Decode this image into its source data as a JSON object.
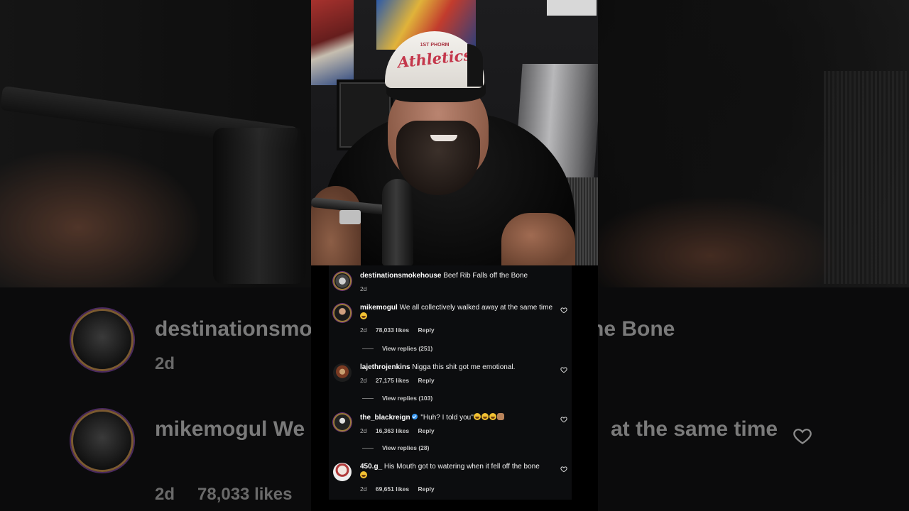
{
  "background": {
    "username": "destinationsmo",
    "username_tail": "he Bone",
    "time": "2d",
    "second_username": "mikemogul We",
    "second_tail": "at the same time",
    "second_time": "2d",
    "second_likes": "78,033 likes"
  },
  "video": {
    "cap_small_text": "1ST PHORM",
    "cap_logo_text": "Athletics"
  },
  "comments": [
    {
      "username": "destinationsmokehouse",
      "text": "Beef Rib Falls off the Bone",
      "time": "2d",
      "likes": "",
      "reply_label": "",
      "avatar_icon": "smokehouse-logo-icon",
      "view_replies": ""
    },
    {
      "username": "mikemogul",
      "text": "We all collectively walked away at the same time",
      "time": "2d",
      "likes": "78,033 likes",
      "reply_label": "Reply",
      "avatar_icon": "user-avatar-icon",
      "view_replies": "View replies (251)"
    },
    {
      "username": "lajethrojenkins",
      "text": "Nigga this shit got me emotional.",
      "time": "2d",
      "likes": "27,175 likes",
      "reply_label": "Reply",
      "avatar_icon": "user-avatar-icon",
      "view_replies": "View replies (103)"
    },
    {
      "username": "the_blackreign",
      "text": "\"Huh? I told you\"",
      "time": "2d",
      "likes": "16,363 likes",
      "reply_label": "Reply",
      "avatar_icon": "user-avatar-icon",
      "view_replies": "View replies (28)"
    },
    {
      "username": "450.g_",
      "text": "His Mouth got to watering when it fell off the bone",
      "time": "2d",
      "likes": "69,651 likes",
      "reply_label": "Reply",
      "avatar_icon": "user-avatar-icon",
      "view_replies": ""
    }
  ],
  "colors": {
    "verified": "#3897f0",
    "panel_bg": "#0c0d0f",
    "cap_logo": "#c4374b"
  }
}
